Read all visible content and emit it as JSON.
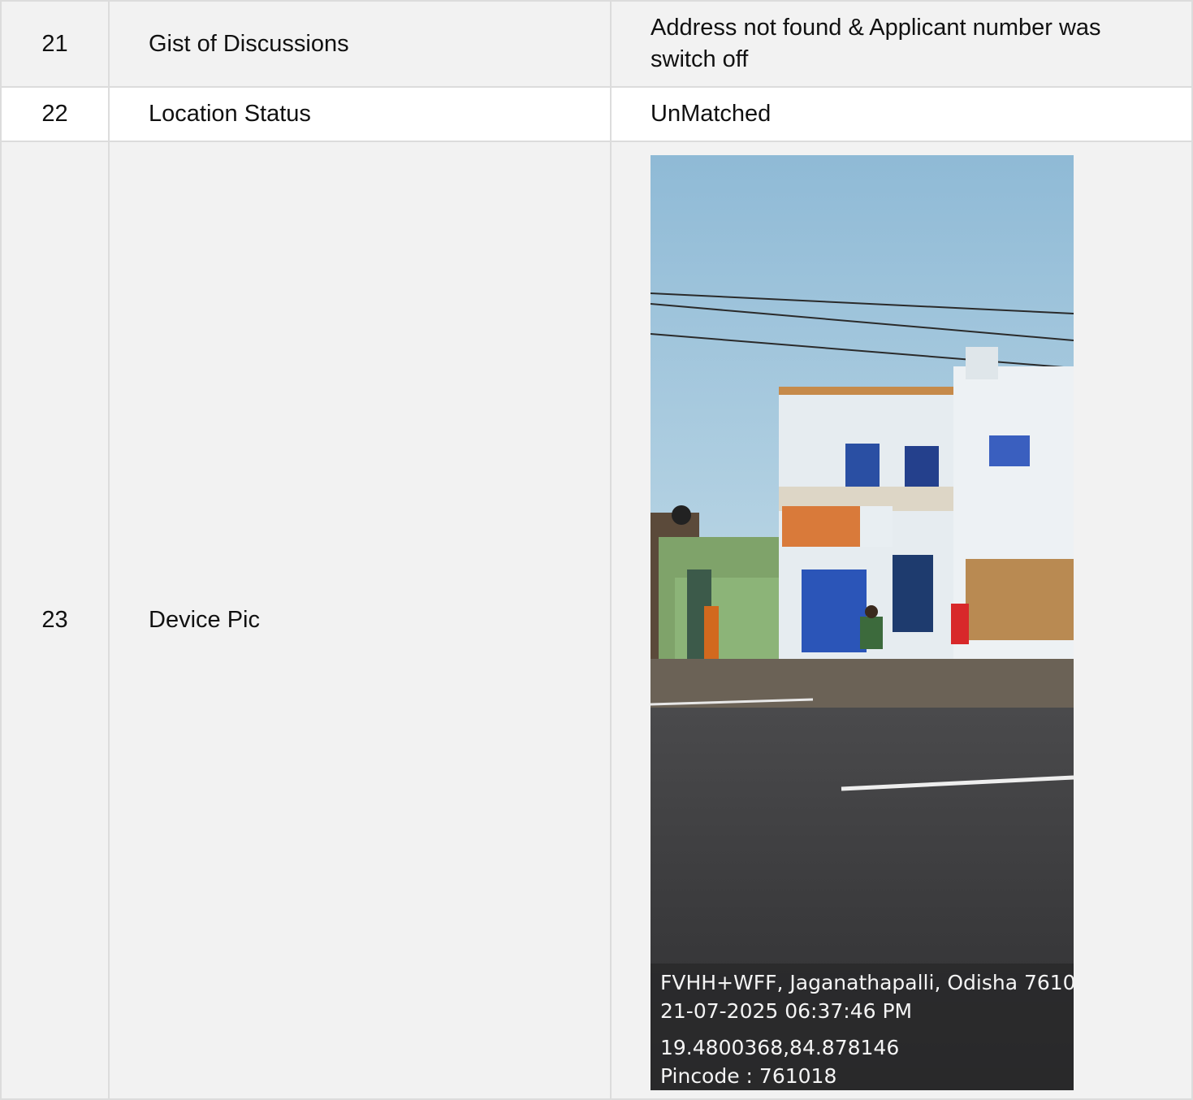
{
  "rows": [
    {
      "no": "21",
      "field": "Gist of Discussions",
      "value": "Address not found & Applicant number was switch off"
    },
    {
      "no": "22",
      "field": "Location Status",
      "value": "UnMatched"
    },
    {
      "no": "23",
      "field": "Device Pic"
    }
  ],
  "photo_stamp": {
    "address": "FVHH+WFF, Jaganathapalli, Odisha 7610",
    "datetime": "21-07-2025 06:37:46 PM",
    "coordinates": "19.4800368,84.878146",
    "pincode": "Pincode : 761018"
  },
  "colors": {
    "row_alt": "#f2f2f2",
    "border": "#dcdcdc",
    "sky": "#9cc3dc",
    "road": "#3f3f41",
    "wall": "#e9eef2",
    "door_blue": "#2a52b8"
  }
}
